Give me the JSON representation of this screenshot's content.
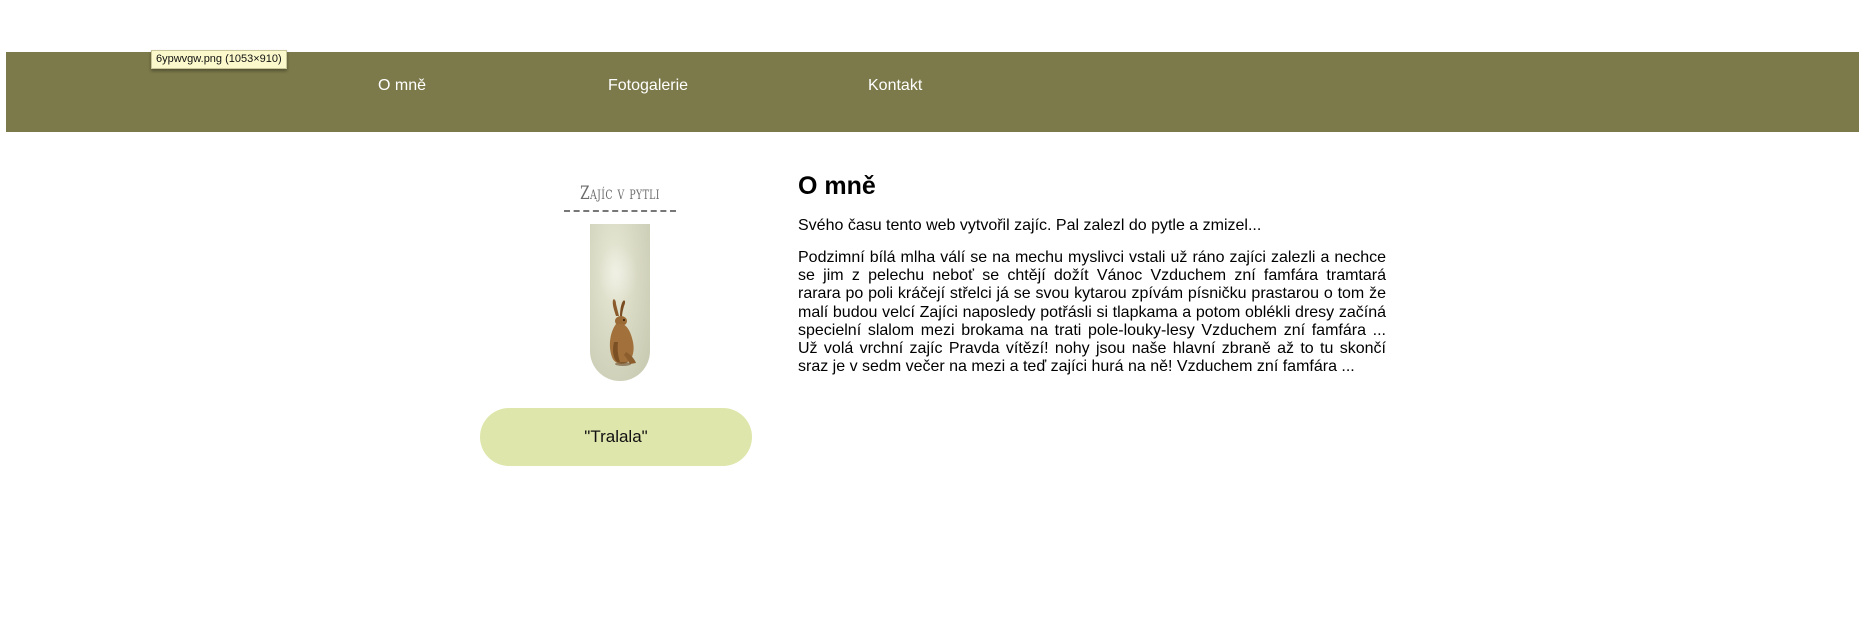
{
  "tooltip": {
    "text": "6ypwvgw.png (1053×910)"
  },
  "nav": {
    "items": [
      {
        "label": "O mně"
      },
      {
        "label": "Fotogalerie"
      },
      {
        "label": "Kontakt"
      }
    ]
  },
  "sidebar": {
    "site_title": "Zajíc v pytli",
    "quote": "\"Tralala\""
  },
  "content": {
    "heading": "O mně",
    "intro": "Svého času tento web vytvořil zajíc. Pal zalezl do pytle a zmizel...",
    "body": "Podzimní bílá mlha válí se na mechu myslivci vstali už ráno zajíci zalezli a nechce se jim z pelechu neboť se chtějí dožít Vánoc Vzduchem zní famfára tramtará rarara po poli kráčejí střelci já se svou kytarou zpívám písničku prastarou o tom že malí budou velcí Zajíci naposledy potřásli si tlapkama a potom oblékli dresy začíná specielní slalom mezi brokama na trati pole-louky-lesy Vzduchem zní famfára ... Už volá vrchní zajíc Pravda vítězí! nohy jsou naše hlavní zbraně až to tu skončí sraz je v sedm večer na mezi a teď zajíci hurá na ně! Vzduchem zní famfára ..."
  },
  "colors": {
    "navbar": "#7c7a4a",
    "quote_pill": "#dfe6ab"
  }
}
